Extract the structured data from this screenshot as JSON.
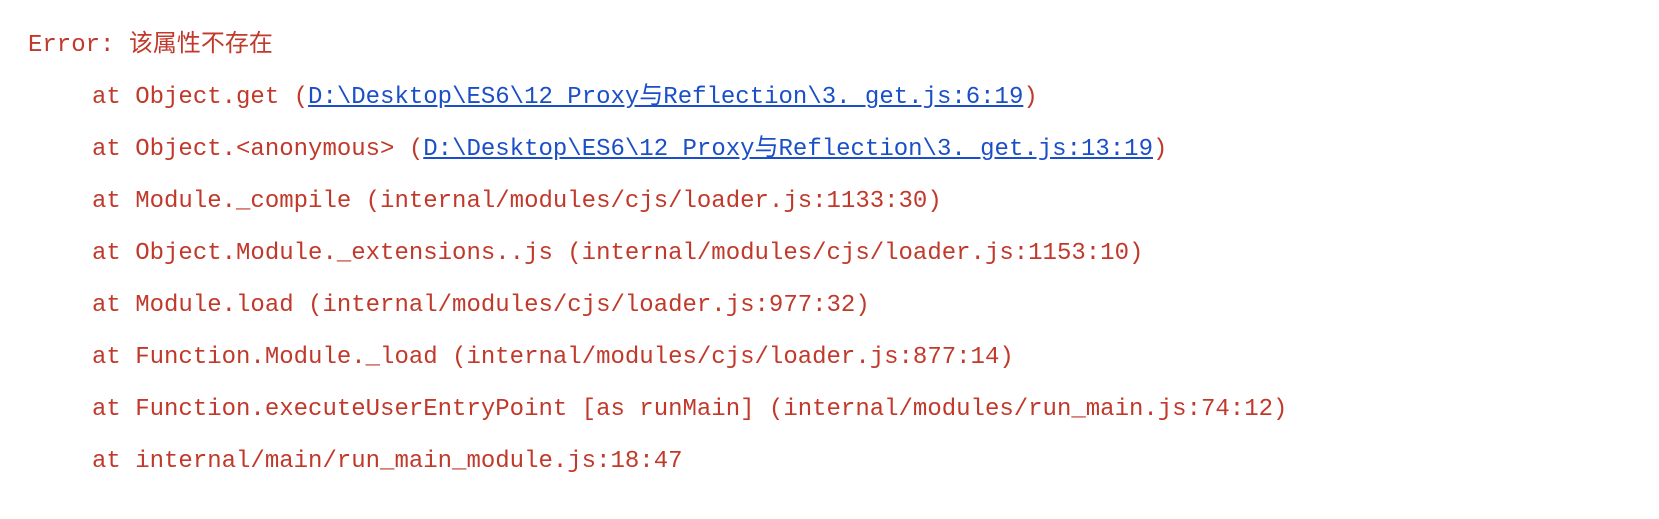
{
  "error": {
    "label": "Error:",
    "message": " 该属性不存在"
  },
  "stack": [
    {
      "prefix": "at Object.get (",
      "link": "D:\\Desktop\\ES6\\12 Proxy与Reflection\\3. get.js:6:19",
      "suffix": ")"
    },
    {
      "prefix": "at Object.<anonymous> (",
      "link": "D:\\Desktop\\ES6\\12 Proxy与Reflection\\3. get.js:13:19",
      "suffix": ")"
    },
    {
      "prefix": "at Module._compile (internal/modules/cjs/loader.js:1133:30)",
      "link": "",
      "suffix": ""
    },
    {
      "prefix": "at Object.Module._extensions..js (internal/modules/cjs/loader.js:1153:10)",
      "link": "",
      "suffix": ""
    },
    {
      "prefix": "at Module.load (internal/modules/cjs/loader.js:977:32)",
      "link": "",
      "suffix": ""
    },
    {
      "prefix": "at Function.Module._load (internal/modules/cjs/loader.js:877:14)",
      "link": "",
      "suffix": ""
    },
    {
      "prefix": "at Function.executeUserEntryPoint [as runMain] (internal/modules/run_main.js:74:12)",
      "link": "",
      "suffix": ""
    },
    {
      "prefix": "at internal/main/run_main_module.js:18:47",
      "link": "",
      "suffix": ""
    }
  ]
}
